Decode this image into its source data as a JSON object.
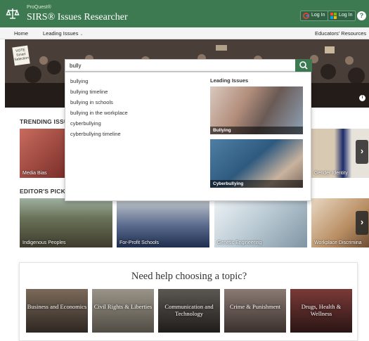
{
  "header": {
    "brand_small": "ProQuest®",
    "brand_title": "SIRS® Issues Researcher",
    "google_login": "Log In",
    "ms_login": "Log In",
    "help": "?"
  },
  "nav": {
    "home": "Home",
    "leading_issues": "Leading Issues",
    "educators": "Educators' Resources"
  },
  "hero": {
    "sign_text": "VOTE Smart Selection"
  },
  "search": {
    "value": "bully",
    "suggestions": [
      "bullying",
      "bullying timeline",
      "bullying in schools",
      "bullying in the workplace",
      "cyberbullying",
      "cyberbullying timeline"
    ],
    "leading_issues_heading": "Leading Issues",
    "leading_issues": [
      "Bullying",
      "Cyberbullying"
    ]
  },
  "trending": {
    "heading": "TRENDING ISSU",
    "tiles": [
      "Media Bias",
      "Gender Identity"
    ]
  },
  "editors": {
    "heading": "EDITOR'S PICKS",
    "tiles": [
      "Indigenous Peoples",
      "For-Profit Schools",
      "Genetic Engineering",
      "Workplace Discrimina"
    ]
  },
  "help_panel": {
    "title": "Need help choosing a topic?",
    "topics": [
      "Business and Economics",
      "Civil Rights & Liberties",
      "Communication and Technology",
      "Crime & Punishment",
      "Drugs, Health & Wellness"
    ]
  },
  "colors": {
    "brand_green": "#3d7a52",
    "header_text": "#ffffff"
  }
}
